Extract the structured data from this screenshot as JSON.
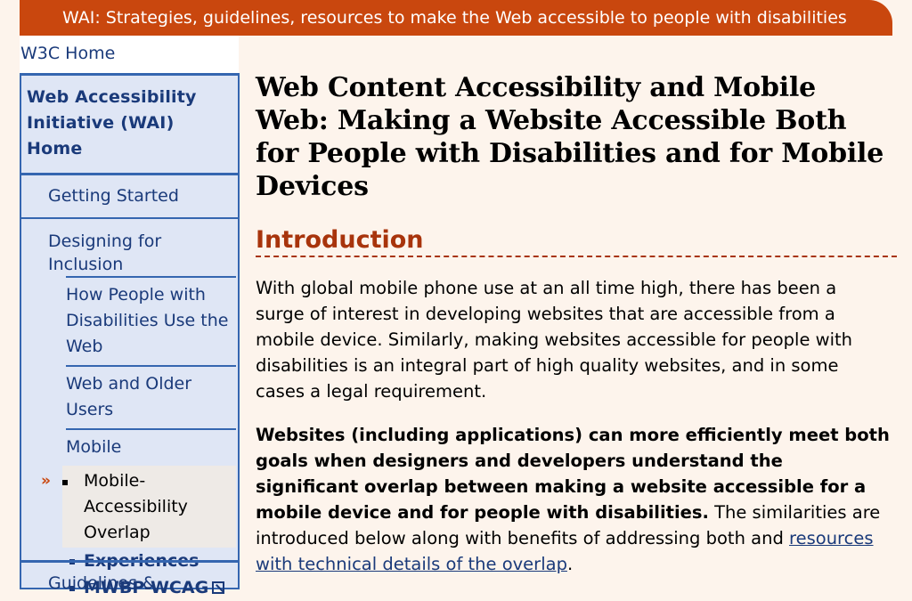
{
  "banner": {
    "text": "WAI: Strategies, guidelines, resources to make the Web accessible to people with disabilities"
  },
  "w3c_home": {
    "label": "W3C Home"
  },
  "sidebar": {
    "wai_home": "Web Accessibility Initiative (WAI) Home",
    "getting_started": "Getting Started",
    "designing": "Designing for Inclusion",
    "sub_items": [
      "How People with Disabilities Use the Web",
      "Web and Older Users",
      "Mobile"
    ],
    "current_marker": "»",
    "current": "Mobile-Accessibility Overlap",
    "subsub": [
      "Experiences",
      "MWBP-WCAG"
    ],
    "next_partial": "Guidelines &"
  },
  "main": {
    "title": "Web Content Accessibility and Mobile Web: Making a Website Accessible Both for People with Disabilities and for Mobile Devices",
    "section_heading": "Introduction",
    "para1": "With global mobile phone use at an all time high, there has been a surge of interest in developing websites that are accessible from a mobile device. Similarly, making websites accessible for people with disabilities is an integral part of high quality websites, and in some cases a legal requirement.",
    "para2_bold": "Websites (including applications) can more efficiently meet both goals when designers and developers understand the significant overlap between making a website accessible for a mobile device and for people with disabilities.",
    "para2_rest": " The similarities are introduced below along with benefits of addressing both and ",
    "para2_link": "resources with technical details of the overlap",
    "para2_end": "."
  },
  "colors": {
    "banner": "#c9470e",
    "sidebar_bg": "#dfe6f5",
    "sidebar_border": "#3566b0",
    "link": "#1a3a7a",
    "heading": "#a8340c",
    "page_bg": "#fdf4ec"
  },
  "icons": [
    "external-link-icon",
    "current-page-marker-icon",
    "bullet-icon"
  ]
}
